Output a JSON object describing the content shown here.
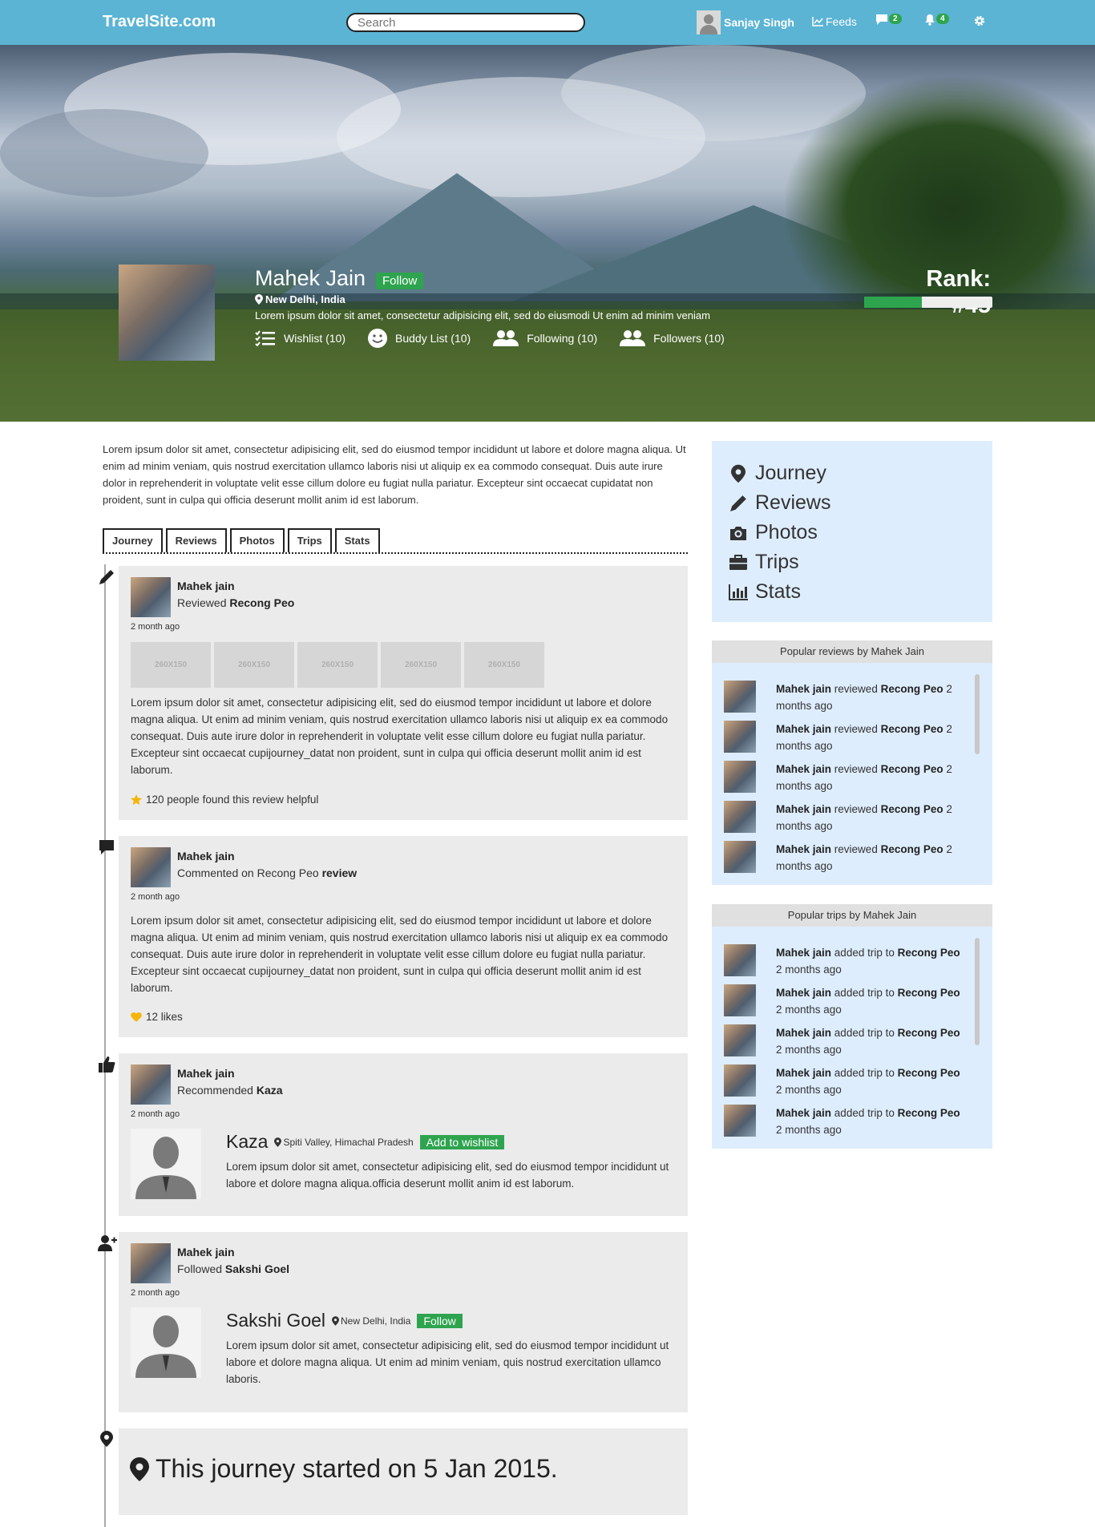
{
  "topbar": {
    "logo": "TravelSite.com",
    "search_placeholder": "Search",
    "user_name": "Sanjay Singh",
    "feeds_label": "Feeds",
    "messages_count": "2",
    "notifications_count": "4"
  },
  "profile": {
    "name": "Mahek Jain",
    "follow_label": "Follow",
    "location": "New Delhi, India",
    "bio": "Lorem ipsum dolor sit amet, consectetur adipisicing elit, sed do eiusmodi Ut enim ad minim veniam",
    "stats": [
      {
        "label": "Wishlist (10)",
        "icon": "checklist-icon"
      },
      {
        "label": "Buddy List (10)",
        "icon": "smiley-icon"
      },
      {
        "label": "Following (10)",
        "icon": "users-icon"
      },
      {
        "label": "Followers (10)",
        "icon": "users-icon"
      }
    ],
    "rank": "Rank: #45",
    "rank_progress": 0.45
  },
  "about": "Lorem ipsum dolor sit amet, consectetur adipisicing elit, sed do eiusmod tempor incididunt ut labore et dolore magna aliqua. Ut enim ad minim veniam, quis nostrud exercitation ullamco laboris nisi ut aliquip ex ea commodo consequat. Duis aute irure dolor in reprehenderit in voluptate velit esse cillum dolore eu fugiat nulla pariatur. Excepteur sint occaecat cupidatat non proident, sunt in culpa qui officia deserunt mollit anim id est laborum.",
  "tabs": [
    "Journey",
    "Reviews",
    "Photos",
    "Trips",
    "Stats"
  ],
  "timeline": {
    "review": {
      "name": "Mahek jain",
      "action": "Reviewed",
      "target": "Recong Peo",
      "time": "2 month ago",
      "photos": [
        "260X150",
        "260X150",
        "260X150",
        "260X150",
        "260X150"
      ],
      "body": "Lorem ipsum dolor sit amet, consectetur adipisicing elit, sed do eiusmod tempor incididunt ut labore et dolore magna aliqua. Ut enim ad minim veniam, quis nostrud exercitation ullamco laboris nisi ut aliquip ex ea commodo consequat. Duis aute irure dolor in reprehenderit in voluptate velit esse cillum dolore eu fugiat nulla pariatur. Excepteur sint occaecat cupijourney_datat non proident, sunt in culpa qui officia deserunt mollit anim id est laborum.",
      "helpful": "120 people found this review helpful"
    },
    "comment": {
      "name": "Mahek jain",
      "action": "Commented on Recong Peo",
      "target": "review",
      "time": "2 month ago",
      "body": "Lorem ipsum dolor sit amet, consectetur adipisicing elit, sed do eiusmod tempor incididunt ut labore et dolore magna aliqua. Ut enim ad minim veniam, quis nostrud exercitation ullamco laboris nisi ut aliquip ex ea commodo consequat. Duis aute irure dolor in reprehenderit in voluptate velit esse cillum dolore eu fugiat nulla pariatur. Excepteur sint occaecat cupijourney_datat non proident, sunt in culpa qui officia deserunt mollit anim id est laborum.",
      "likes": "12 likes"
    },
    "recommend": {
      "name": "Mahek jain",
      "action": "Recommended",
      "target": "Kaza",
      "time": "2 month ago",
      "place_name": "Kaza",
      "place_location": "Spiti Valley, Himachal Pradesh",
      "wishlist_label": "Add to wishlist",
      "place_desc": "Lorem ipsum dolor sit amet, consectetur adipisicing elit, sed do eiusmod tempor incididunt ut labore et dolore magna aliqua.officia deserunt mollit anim id est laborum."
    },
    "follow": {
      "name": "Mahek jain",
      "action": "Followed",
      "target": "Sakshi Goel",
      "time": "2 month ago",
      "person_name": "Sakshi Goel",
      "person_location": "New Delhi, India",
      "follow_label": "Follow",
      "person_desc": "Lorem ipsum dolor sit amet, consectetur adipisicing elit, sed do eiusmod tempor incididunt ut labore et dolore magna aliqua. Ut enim ad minim veniam, quis nostrud exercitation ullamco laboris."
    },
    "journey_start": "This journey started on 5 Jan 2015."
  },
  "sidenav": [
    "Journey",
    "Reviews",
    "Photos",
    "Trips",
    "Stats"
  ],
  "popular_reviews": {
    "title": "Popular reviews by Mahek Jain",
    "items": [
      {
        "name": "Mahek jain",
        "verb": "reviewed",
        "place": "Recong Peo",
        "time": "2 months ago"
      },
      {
        "name": "Mahek jain",
        "verb": "reviewed",
        "place": "Recong Peo",
        "time": "2 months ago"
      },
      {
        "name": "Mahek jain",
        "verb": "reviewed",
        "place": "Recong Peo",
        "time": "2 months ago"
      },
      {
        "name": "Mahek jain",
        "verb": "reviewed",
        "place": "Recong Peo",
        "time": "2 months ago"
      },
      {
        "name": "Mahek jain",
        "verb": "reviewed",
        "place": "Recong Peo",
        "time": "2 months ago"
      }
    ]
  },
  "popular_trips": {
    "title": "Popular trips by Mahek Jain",
    "items": [
      {
        "name": "Mahek jain",
        "verb": "added trip to",
        "place": "Recong Peo",
        "time": "2 months ago"
      },
      {
        "name": "Mahek jain",
        "verb": "added trip to",
        "place": "Recong Peo",
        "time": "2 months ago"
      },
      {
        "name": "Mahek jain",
        "verb": "added trip to",
        "place": "Recong Peo",
        "time": "2 months ago"
      },
      {
        "name": "Mahek jain",
        "verb": "added trip to",
        "place": "Recong Peo",
        "time": "2 months ago"
      },
      {
        "name": "Mahek jain",
        "verb": "added trip to",
        "place": "Recong Peo",
        "time": "2 months ago"
      }
    ]
  },
  "colors": {
    "header": "#5bb4d3",
    "accent_green": "#2ea44f",
    "panel_blue": "#deedfd",
    "card_gray": "#ebebeb"
  }
}
